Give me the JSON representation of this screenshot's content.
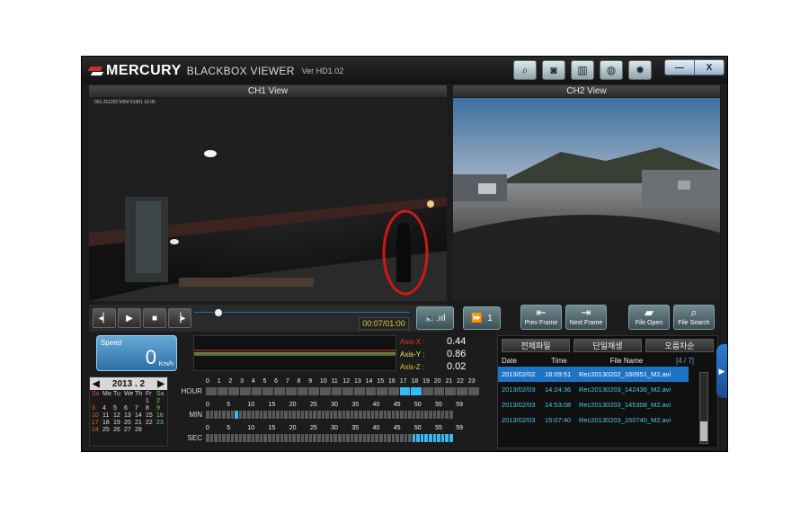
{
  "app": {
    "brand": "MERCURY",
    "subtitle": "BLACKBOX VIEWER",
    "version": "Ver HD1.02",
    "window_buttons": {
      "minimize": "—",
      "close": "X"
    },
    "toolbar_icons": [
      "zoom-icon",
      "camera-icon",
      "map-icon",
      "globe-icon",
      "gear-icon"
    ]
  },
  "views": {
    "ch1_title": "CH1 View",
    "ch2_title": "CH2 View",
    "ch1_overlay": "001.311202 5054 51301 16.05"
  },
  "playback": {
    "time": "00:07/01:00",
    "volume_label": "🔈.ııl",
    "speed_label": "1",
    "progress": 0.12,
    "buttons": [
      "prev",
      "play",
      "stop",
      "next"
    ]
  },
  "frame_buttons": {
    "prev_frame": "Prev Frame",
    "next_frame": "Next Frame",
    "file_open": "File Open",
    "file_search": "File Search"
  },
  "speedometer": {
    "label": "Speed",
    "value": "0",
    "unit": "Km/h"
  },
  "axes": [
    {
      "name": "Axis-X :",
      "value": "0.44",
      "color": "#e0392b"
    },
    {
      "name": "Axis-Y :",
      "value": "0.86",
      "color": "#e8e86a"
    },
    {
      "name": "Axis-Z :",
      "value": "0.02",
      "color": "#e8c23a"
    }
  ],
  "calendar": {
    "title": "2013 . 2",
    "weekdays": [
      "Su",
      "Mo",
      "Tu",
      "We",
      "Th",
      "Fr",
      "Sa"
    ],
    "days": [
      "",
      "",
      "",
      "",
      "",
      "1",
      "2",
      "3",
      "4",
      "5",
      "6",
      "7",
      "8",
      "9",
      "10",
      "11",
      "12",
      "13",
      "14",
      "15",
      "16",
      "17",
      "18",
      "19",
      "20",
      "21",
      "22",
      "23",
      "24",
      "25",
      "26",
      "27",
      "28"
    ]
  },
  "timebars": {
    "hour_label": "HOUR",
    "min_label": "MIN",
    "sec_label": "SEC",
    "hour_ticks": [
      "0",
      "1",
      "2",
      "3",
      "4",
      "5",
      "6",
      "7",
      "8",
      "9",
      "10",
      "11",
      "12",
      "13",
      "14",
      "15",
      "16",
      "17",
      "18",
      "19",
      "20",
      "21",
      "22",
      "23"
    ],
    "min_ticks": [
      "0",
      "5",
      "10",
      "15",
      "20",
      "25",
      "30",
      "35",
      "40",
      "45",
      "50",
      "55",
      "59"
    ],
    "sec_ticks": [
      "0",
      "5",
      "10",
      "15",
      "20",
      "25",
      "30",
      "35",
      "40",
      "45",
      "50",
      "55",
      "59"
    ],
    "hour_active": [
      17,
      18
    ],
    "min_active": [
      7
    ],
    "sec_active_from": 50
  },
  "file_list": {
    "tabs": [
      "전체파일",
      "단일채생",
      "오름차순"
    ],
    "headers": [
      "Date",
      "Time",
      "File Name",
      "[4 / 7]"
    ],
    "rows": [
      {
        "date": "2013/02/02",
        "time": "18:09:51",
        "name": "Rec20130202_180951_M2.avi",
        "selected": true
      },
      {
        "date": "2013/02/03",
        "time": "14:24:36",
        "name": "Rec20130203_142436_M2.avi",
        "selected": false
      },
      {
        "date": "2013/02/03",
        "time": "14:53:08",
        "name": "Rec20130203_145308_M2.avi",
        "selected": false
      },
      {
        "date": "2013/02/03",
        "time": "15:07:40",
        "name": "Rec20130203_150740_M2.avi",
        "selected": false
      }
    ]
  }
}
